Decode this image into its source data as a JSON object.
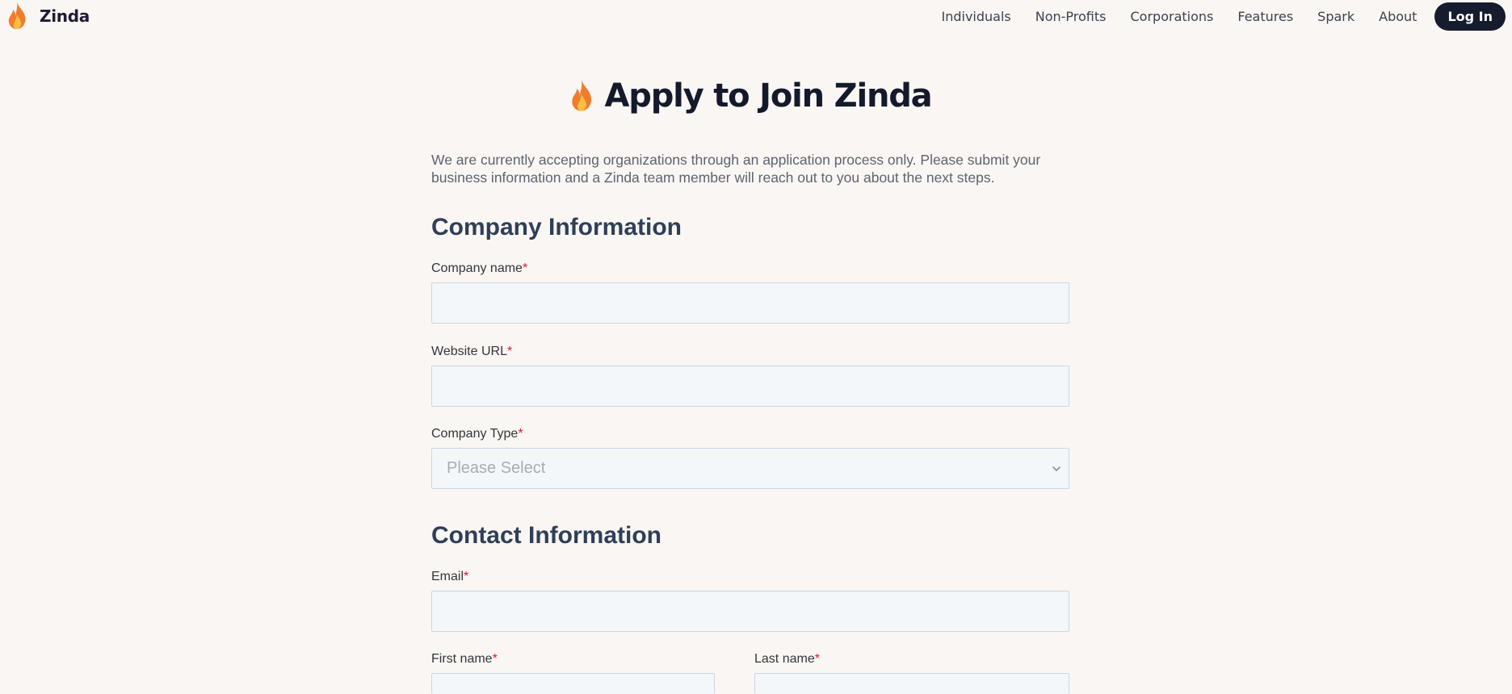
{
  "header": {
    "logo_text": "Zinda",
    "nav": [
      {
        "label": "Individuals"
      },
      {
        "label": "Non-Profits"
      },
      {
        "label": "Corporations"
      },
      {
        "label": "Features"
      },
      {
        "label": "Spark"
      },
      {
        "label": "About"
      }
    ],
    "login_label": "Log In"
  },
  "page": {
    "title": "Apply to Join Zinda",
    "intro": "We are currently accepting organizations through an application process only.  Please submit your business information and a Zinda team member will reach out to you about the next steps."
  },
  "company_section": {
    "title": "Company Information",
    "company_name": {
      "label": "Company name",
      "required": "*",
      "value": ""
    },
    "website_url": {
      "label": "Website URL",
      "required": "*",
      "value": ""
    },
    "company_type": {
      "label": "Company Type",
      "required": "*",
      "selected": "Please Select"
    }
  },
  "contact_section": {
    "title": "Contact Information",
    "email": {
      "label": "Email",
      "required": "*",
      "value": ""
    },
    "first_name": {
      "label": "First name",
      "required": "*",
      "value": ""
    },
    "last_name": {
      "label": "Last name",
      "required": "*",
      "value": ""
    }
  },
  "icons": {
    "logo": "flame-icon",
    "title": "flame-icon",
    "select": "chevron-down-icon"
  },
  "colors": {
    "background": "#faf6f3",
    "login_button": "#151c2e",
    "section_heading": "#2e3f58",
    "required_mark": "#e0162b",
    "input_fill": "#f3f7fa",
    "input_border": "#c9d7e3",
    "flame_outer": "#f07c2e",
    "flame_inner": "#fbbf45"
  }
}
